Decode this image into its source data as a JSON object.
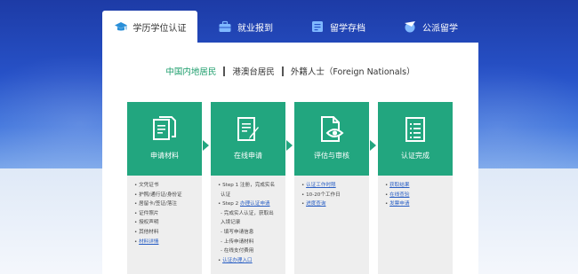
{
  "colors": {
    "accent": "#22a67f",
    "link": "#2a5fc4",
    "bg_blue": "#2752c8"
  },
  "tabs": [
    {
      "label": "学历学位认证",
      "icon": "graduation-cap-icon",
      "active": true
    },
    {
      "label": "就业报到",
      "icon": "briefcase-icon",
      "active": false
    },
    {
      "label": "留学存档",
      "icon": "archive-box-icon",
      "active": false
    },
    {
      "label": "公派留学",
      "icon": "airplane-globe-icon",
      "active": false
    }
  ],
  "residency": {
    "options": [
      "中国内地居民",
      "港澳台居民",
      "外籍人士（Foreign Nationals）"
    ],
    "selected": "中国内地居民"
  },
  "steps": [
    {
      "label": "申请材料",
      "icon": "documents-icon"
    },
    {
      "label": "在线申请",
      "icon": "form-edit-icon"
    },
    {
      "label": "评估与审核",
      "icon": "document-eye-icon"
    },
    {
      "label": "认证完成",
      "icon": "checklist-icon"
    }
  ],
  "details": {
    "materials": {
      "items": [
        "• 文凭证书",
        "• 护照/通行证/身份证",
        "• 居留卡/签证/落注",
        "• 证件照片",
        "• 授权声明",
        "• 其他材料"
      ],
      "link": "材料详情"
    },
    "apply": {
      "step1_a": "• Step 1 注册，完成实名",
      "step1_b": "认证",
      "step2_prefix": "• Step 2 ",
      "step2_link": "办理认证申请",
      "sub": [
        "- 完成实人认证，获取出",
        "入境记录",
        "- 填写申请信息",
        "- 上传申请材料",
        "- 在线支付费用"
      ],
      "entry_link": "认证办理入口"
    },
    "review": {
      "link1": "认证工作时限",
      "text": "• 10-20个工作日",
      "link2": "进度查询"
    },
    "complete": {
      "links": [
        "获取结果",
        "在线查验",
        "发票申请"
      ]
    }
  }
}
